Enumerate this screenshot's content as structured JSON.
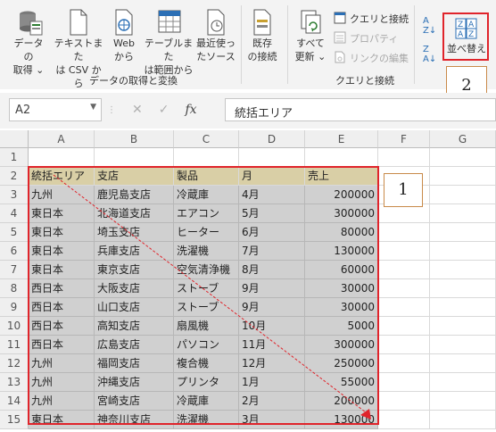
{
  "ribbon": {
    "buttons": [
      {
        "label1": "データの",
        "label2": "取得 ⌄",
        "icon": "database-icon"
      },
      {
        "label1": "テキストまた",
        "label2": "は CSV から",
        "icon": "text-file-icon"
      },
      {
        "label1": "Web",
        "label2": "から",
        "icon": "web-page-icon"
      },
      {
        "label1": "テーブルまた",
        "label2": "は範囲から",
        "icon": "table-range-icon"
      },
      {
        "label1": "最近使っ",
        "label2": "たソース",
        "icon": "recent-sources-icon"
      },
      {
        "label1": "既存",
        "label2": "の接続",
        "icon": "existing-connections-icon"
      },
      {
        "label1": "すべて",
        "label2": "更新 ⌄",
        "icon": "refresh-all-icon"
      }
    ],
    "query_items": [
      "クエリと接続",
      "プロパティ",
      "リンクの編集"
    ],
    "group1_label": "データの取得と変換",
    "group2_label": "クエリと接続",
    "sort_label": "並べ替え"
  },
  "formula_bar": {
    "name_box": "A2",
    "formula": "統括エリア"
  },
  "columns": [
    "A",
    "B",
    "C",
    "D",
    "E",
    "F",
    "G"
  ],
  "rows": [
    "1",
    "2",
    "3",
    "4",
    "5",
    "6",
    "7",
    "8",
    "9",
    "10",
    "11",
    "12",
    "13",
    "14",
    "15"
  ],
  "table": {
    "headers": [
      "統括エリア",
      "支店",
      "製品",
      "月",
      "売上"
    ],
    "data": [
      [
        "九州",
        "鹿児島支店",
        "冷蔵庫",
        "4月",
        "200000"
      ],
      [
        "東日本",
        "北海道支店",
        "エアコン",
        "5月",
        "300000"
      ],
      [
        "東日本",
        "埼玉支店",
        "ヒーター",
        "6月",
        "80000"
      ],
      [
        "東日本",
        "兵庫支店",
        "洗濯機",
        "7月",
        "130000"
      ],
      [
        "東日本",
        "東京支店",
        "空気清浄機",
        "8月",
        "60000"
      ],
      [
        "西日本",
        "大阪支店",
        "ストーブ",
        "9月",
        "30000"
      ],
      [
        "西日本",
        "山口支店",
        "ストーブ",
        "9月",
        "30000"
      ],
      [
        "西日本",
        "高知支店",
        "扇風機",
        "10月",
        "5000"
      ],
      [
        "西日本",
        "広島支店",
        "パソコン",
        "11月",
        "300000"
      ],
      [
        "九州",
        "福岡支店",
        "複合機",
        "12月",
        "250000"
      ],
      [
        "九州",
        "沖縄支店",
        "プリンタ",
        "1月",
        "55000"
      ],
      [
        "九州",
        "宮崎支店",
        "冷蔵庫",
        "2月",
        "200000"
      ],
      [
        "東日本",
        "神奈川支店",
        "洗濯機",
        "3月",
        "130000"
      ]
    ]
  },
  "annotations": {
    "callout1": "1",
    "callout2": "2"
  },
  "colors": {
    "highlight_red": "#e0242b",
    "callout_border": "#c98a4a",
    "header_fill": "#d9cfa6",
    "body_fill": "#d0d0d0"
  }
}
